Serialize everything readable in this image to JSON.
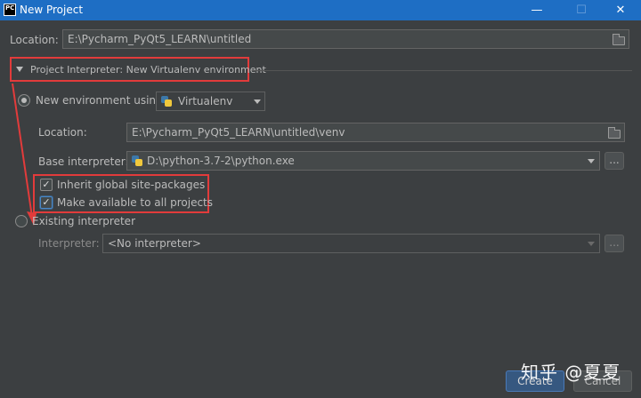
{
  "window": {
    "title": "New Project",
    "app_icon": "PC",
    "minimize_icon": "—",
    "maximize_icon": "☐",
    "close_icon": "✕"
  },
  "project_location": {
    "label": "Location:",
    "value": "E:\\Pycharm_PyQt5_LEARN\\untitled"
  },
  "interpreter_section": {
    "title": "Project Interpreter: New Virtualenv environment"
  },
  "new_environment": {
    "label": "New environment using",
    "tool": "Virtualenv",
    "location_label": "Location:",
    "location_value": "E:\\Pycharm_PyQt5_LEARN\\untitled\\venv",
    "base_interpreter_label": "Base interpreter:",
    "base_interpreter_value": "D:\\python-3.7-2\\python.exe",
    "browse_label": "...",
    "inherit_label": "Inherit global site-packages",
    "inherit_checked": true,
    "make_available_label": "Make available to all projects",
    "make_available_checked": true,
    "checkmark": "✓"
  },
  "existing_interpreter": {
    "label": "Existing interpreter",
    "interpreter_label": "Interpreter:",
    "interpreter_value": "<No interpreter>",
    "browse_label": "..."
  },
  "buttons": {
    "create": "Create",
    "cancel": "Cancel"
  },
  "watermark": "知乎 @夏夏",
  "colors": {
    "annotation": "#e23b3b",
    "titlebar": "#1e6ec4",
    "background": "#3c3f41"
  }
}
